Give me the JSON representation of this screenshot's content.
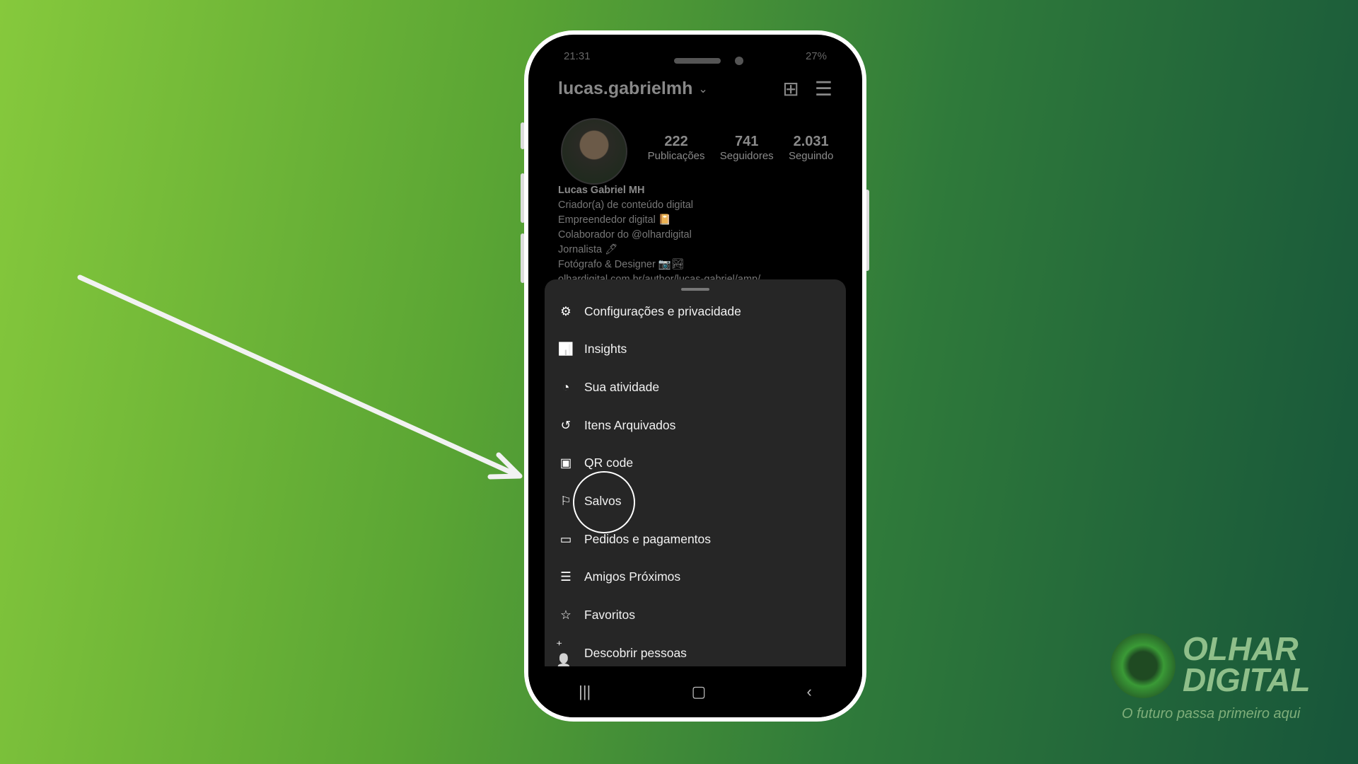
{
  "status": {
    "time": "21:31",
    "battery": "27%"
  },
  "profile": {
    "username": "lucas.gabrielmh",
    "stats": [
      {
        "value": "222",
        "label": "Publicações"
      },
      {
        "value": "741",
        "label": "Seguidores"
      },
      {
        "value": "2.031",
        "label": "Seguindo"
      }
    ],
    "name": "Lucas Gabriel MH",
    "bio": [
      "Criador(a) de conteúdo digital",
      "Empreendedor digital 📔",
      "Colaborador do @olhardigital",
      "Jornalista 🖊",
      "Fotógrafo  & Designer 📷🏞",
      "olhardigital.com.br/author/lucas-gabriel/amp/"
    ]
  },
  "menu": [
    {
      "label": "Configurações e privacidade",
      "icon": "settings-icon"
    },
    {
      "label": "Insights",
      "icon": "bar-chart-icon"
    },
    {
      "label": "Sua atividade",
      "icon": "activity-icon"
    },
    {
      "label": "Itens Arquivados",
      "icon": "archive-icon"
    },
    {
      "label": "QR code",
      "icon": "qr-code-icon"
    },
    {
      "label": "Salvos",
      "icon": "bookmark-icon"
    },
    {
      "label": "Pedidos e pagamentos",
      "icon": "card-icon"
    },
    {
      "label": "Amigos Próximos",
      "icon": "close-friends-icon"
    },
    {
      "label": "Favoritos",
      "icon": "star-icon"
    },
    {
      "label": "Descobrir pessoas",
      "icon": "add-person-icon"
    }
  ],
  "logo": {
    "brand_line1": "OLHAR",
    "brand_line2": "DIGITAL",
    "tagline": "O futuro passa primeiro aqui"
  }
}
